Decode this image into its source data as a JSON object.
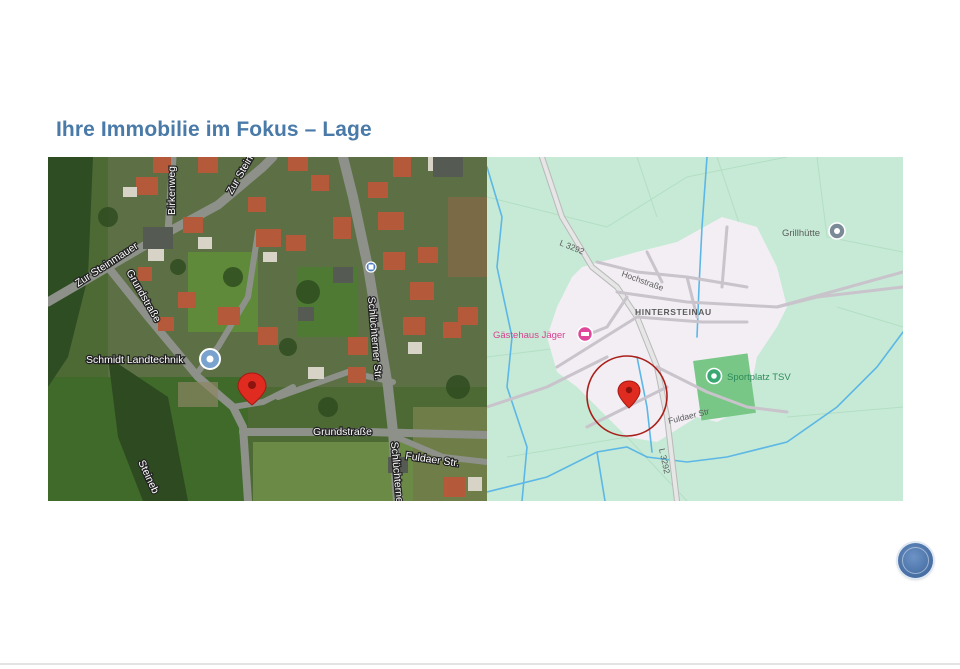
{
  "slide": {
    "title": "Ihre Immobilie im Fokus – Lage"
  },
  "satellite_map": {
    "labels": {
      "birkenweg": "Birkenweg",
      "zur_stein_top": "Zur Stein",
      "zur_steinmauer": "Zur Steinmauer",
      "grundstrasse_diag": "Grundstraße",
      "schluechterner_str": "Schlüchterner Str.",
      "grundstrasse": "Grundstraße",
      "schluechterne_cut": "Schlüchterne",
      "fuldaer_str": "Fuldaer Str.",
      "steinebach": "Steineb",
      "poi_name": "Schmidt Landtechnik"
    },
    "icons": {
      "poi": "place-pin-icon",
      "marker": "red-location-pin-icon",
      "bus": "bus-stop-icon"
    },
    "colors": {
      "marker": "#e02b20"
    }
  },
  "road_map": {
    "labels": {
      "l3292_top": "L 3292",
      "hochstrasse": "Hochstraße",
      "hintersteinau": "HINTERSTEINAU",
      "grillhuette": "Grillhütte",
      "gaestehaus": "Gästehaus Jäger",
      "sportplatz": "Sportplatz TSV",
      "fuldaer_str": "Fuldaer Str",
      "l3292_bottom": "L 3292"
    },
    "icons": {
      "grillhuette": "place-pin-icon",
      "gaestehaus": "hotel-icon",
      "sportplatz": "sports-pin-icon",
      "marker": "red-location-pin-icon",
      "highlight": "highlight-circle"
    },
    "colors": {
      "land": "#c6ead6",
      "settlement": "#f2eef4",
      "water": "#5cb7e6",
      "hotel": "#e0469a",
      "park": "#3aa872",
      "highlight": "#a9201a",
      "marker": "#e02b20"
    }
  },
  "navigation": {
    "icon": "slide-nav-button"
  }
}
